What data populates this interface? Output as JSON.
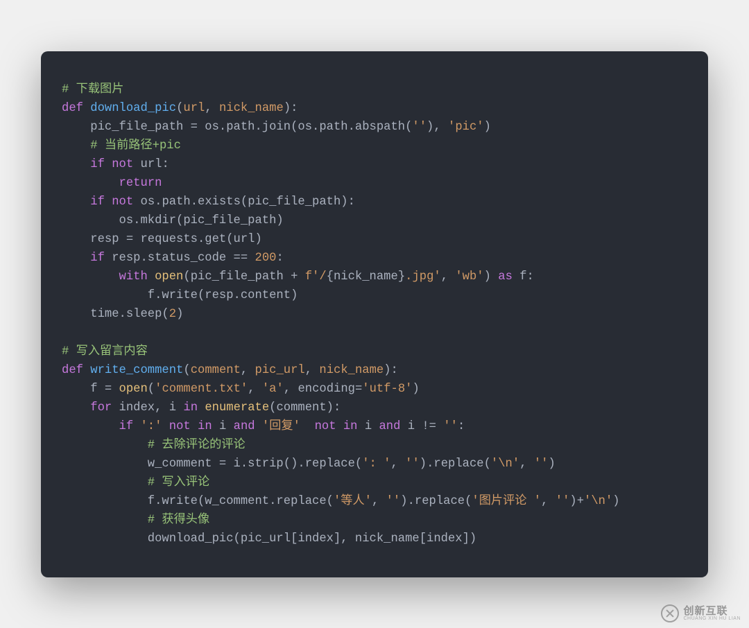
{
  "code": {
    "lines": [
      {
        "indent": 0,
        "tokens": [
          {
            "cls": "c-comment",
            "text": "# 下载图片"
          }
        ]
      },
      {
        "indent": 0,
        "tokens": [
          {
            "cls": "c-keyword",
            "text": "def"
          },
          {
            "cls": "c-punct",
            "text": " "
          },
          {
            "cls": "c-funcname",
            "text": "download_pic"
          },
          {
            "cls": "c-punct",
            "text": "("
          },
          {
            "cls": "c-param",
            "text": "url"
          },
          {
            "cls": "c-punct",
            "text": ", "
          },
          {
            "cls": "c-param",
            "text": "nick_name"
          },
          {
            "cls": "c-punct",
            "text": "):"
          }
        ]
      },
      {
        "indent": 1,
        "tokens": [
          {
            "cls": "c-ident",
            "text": "pic_file_path = os.path.join(os.path.abspath("
          },
          {
            "cls": "c-string",
            "text": "''"
          },
          {
            "cls": "c-ident",
            "text": "), "
          },
          {
            "cls": "c-string",
            "text": "'pic'"
          },
          {
            "cls": "c-ident",
            "text": ")"
          }
        ]
      },
      {
        "indent": 1,
        "tokens": [
          {
            "cls": "c-comment",
            "text": "# 当前路径+pic"
          }
        ]
      },
      {
        "indent": 1,
        "tokens": [
          {
            "cls": "c-keyword",
            "text": "if"
          },
          {
            "cls": "c-ident",
            "text": " "
          },
          {
            "cls": "c-keyword",
            "text": "not"
          },
          {
            "cls": "c-ident",
            "text": " url:"
          }
        ]
      },
      {
        "indent": 2,
        "tokens": [
          {
            "cls": "c-keyword",
            "text": "return"
          }
        ]
      },
      {
        "indent": 1,
        "tokens": [
          {
            "cls": "c-keyword",
            "text": "if"
          },
          {
            "cls": "c-ident",
            "text": " "
          },
          {
            "cls": "c-keyword",
            "text": "not"
          },
          {
            "cls": "c-ident",
            "text": " os.path.exists(pic_file_path):"
          }
        ]
      },
      {
        "indent": 2,
        "tokens": [
          {
            "cls": "c-ident",
            "text": "os.mkdir(pic_file_path)"
          }
        ]
      },
      {
        "indent": 1,
        "tokens": [
          {
            "cls": "c-ident",
            "text": "resp = requests.get(url)"
          }
        ]
      },
      {
        "indent": 1,
        "tokens": [
          {
            "cls": "c-keyword",
            "text": "if"
          },
          {
            "cls": "c-ident",
            "text": " resp.status_code == "
          },
          {
            "cls": "c-number",
            "text": "200"
          },
          {
            "cls": "c-ident",
            "text": ":"
          }
        ]
      },
      {
        "indent": 2,
        "tokens": [
          {
            "cls": "c-keyword",
            "text": "with"
          },
          {
            "cls": "c-ident",
            "text": " "
          },
          {
            "cls": "c-builtin",
            "text": "open"
          },
          {
            "cls": "c-ident",
            "text": "(pic_file_path + "
          },
          {
            "cls": "c-string",
            "text": "f'/"
          },
          {
            "cls": "c-fstr-brace",
            "text": "{nick_name}"
          },
          {
            "cls": "c-string",
            "text": ".jpg'"
          },
          {
            "cls": "c-ident",
            "text": ", "
          },
          {
            "cls": "c-string",
            "text": "'wb'"
          },
          {
            "cls": "c-ident",
            "text": ") "
          },
          {
            "cls": "c-keyword",
            "text": "as"
          },
          {
            "cls": "c-ident",
            "text": " f:"
          }
        ]
      },
      {
        "indent": 3,
        "tokens": [
          {
            "cls": "c-ident",
            "text": "f.write(resp.content)"
          }
        ]
      },
      {
        "indent": 1,
        "tokens": [
          {
            "cls": "c-ident",
            "text": "time.sleep("
          },
          {
            "cls": "c-number",
            "text": "2"
          },
          {
            "cls": "c-ident",
            "text": ")"
          }
        ]
      },
      {
        "indent": 0,
        "tokens": []
      },
      {
        "indent": 0,
        "tokens": [
          {
            "cls": "c-comment",
            "text": "# 写入留言内容"
          }
        ]
      },
      {
        "indent": 0,
        "tokens": [
          {
            "cls": "c-keyword",
            "text": "def"
          },
          {
            "cls": "c-punct",
            "text": " "
          },
          {
            "cls": "c-funcname",
            "text": "write_comment"
          },
          {
            "cls": "c-punct",
            "text": "("
          },
          {
            "cls": "c-param",
            "text": "comment"
          },
          {
            "cls": "c-punct",
            "text": ", "
          },
          {
            "cls": "c-param",
            "text": "pic_url"
          },
          {
            "cls": "c-punct",
            "text": ", "
          },
          {
            "cls": "c-param",
            "text": "nick_name"
          },
          {
            "cls": "c-punct",
            "text": "):"
          }
        ]
      },
      {
        "indent": 1,
        "tokens": [
          {
            "cls": "c-ident",
            "text": "f = "
          },
          {
            "cls": "c-builtin",
            "text": "open"
          },
          {
            "cls": "c-ident",
            "text": "("
          },
          {
            "cls": "c-string",
            "text": "'comment.txt'"
          },
          {
            "cls": "c-ident",
            "text": ", "
          },
          {
            "cls": "c-string",
            "text": "'a'"
          },
          {
            "cls": "c-ident",
            "text": ", encoding="
          },
          {
            "cls": "c-string",
            "text": "'utf-8'"
          },
          {
            "cls": "c-ident",
            "text": ")"
          }
        ]
      },
      {
        "indent": 1,
        "tokens": [
          {
            "cls": "c-keyword",
            "text": "for"
          },
          {
            "cls": "c-ident",
            "text": " index, i "
          },
          {
            "cls": "c-keyword",
            "text": "in"
          },
          {
            "cls": "c-ident",
            "text": " "
          },
          {
            "cls": "c-builtin",
            "text": "enumerate"
          },
          {
            "cls": "c-ident",
            "text": "(comment):"
          }
        ]
      },
      {
        "indent": 2,
        "tokens": [
          {
            "cls": "c-keyword",
            "text": "if"
          },
          {
            "cls": "c-ident",
            "text": " "
          },
          {
            "cls": "c-string",
            "text": "':'"
          },
          {
            "cls": "c-ident",
            "text": " "
          },
          {
            "cls": "c-keyword",
            "text": "not"
          },
          {
            "cls": "c-ident",
            "text": " "
          },
          {
            "cls": "c-keyword",
            "text": "in"
          },
          {
            "cls": "c-ident",
            "text": " i "
          },
          {
            "cls": "c-keyword",
            "text": "and"
          },
          {
            "cls": "c-ident",
            "text": " "
          },
          {
            "cls": "c-string",
            "text": "'回复'"
          },
          {
            "cls": "c-ident",
            "text": "  "
          },
          {
            "cls": "c-keyword",
            "text": "not"
          },
          {
            "cls": "c-ident",
            "text": " "
          },
          {
            "cls": "c-keyword",
            "text": "in"
          },
          {
            "cls": "c-ident",
            "text": " i "
          },
          {
            "cls": "c-keyword",
            "text": "and"
          },
          {
            "cls": "c-ident",
            "text": " i != "
          },
          {
            "cls": "c-string",
            "text": "''"
          },
          {
            "cls": "c-ident",
            "text": ":"
          }
        ]
      },
      {
        "indent": 3,
        "tokens": [
          {
            "cls": "c-comment",
            "text": "# 去除评论的评论"
          }
        ]
      },
      {
        "indent": 3,
        "tokens": [
          {
            "cls": "c-ident",
            "text": "w_comment = i.strip().replace("
          },
          {
            "cls": "c-string",
            "text": "': '"
          },
          {
            "cls": "c-ident",
            "text": ", "
          },
          {
            "cls": "c-string",
            "text": "''"
          },
          {
            "cls": "c-ident",
            "text": ").replace("
          },
          {
            "cls": "c-string",
            "text": "'\\n'"
          },
          {
            "cls": "c-ident",
            "text": ", "
          },
          {
            "cls": "c-string",
            "text": "''"
          },
          {
            "cls": "c-ident",
            "text": ")"
          }
        ]
      },
      {
        "indent": 3,
        "tokens": [
          {
            "cls": "c-comment",
            "text": "# 写入评论"
          }
        ]
      },
      {
        "indent": 3,
        "tokens": [
          {
            "cls": "c-ident",
            "text": "f.write(w_comment.replace("
          },
          {
            "cls": "c-string",
            "text": "'等人'"
          },
          {
            "cls": "c-ident",
            "text": ", "
          },
          {
            "cls": "c-string",
            "text": "''"
          },
          {
            "cls": "c-ident",
            "text": ").replace("
          },
          {
            "cls": "c-string",
            "text": "'图片评论 '"
          },
          {
            "cls": "c-ident",
            "text": ", "
          },
          {
            "cls": "c-string",
            "text": "''"
          },
          {
            "cls": "c-ident",
            "text": ")+"
          },
          {
            "cls": "c-string",
            "text": "'\\n'"
          },
          {
            "cls": "c-ident",
            "text": ")"
          }
        ]
      },
      {
        "indent": 3,
        "tokens": [
          {
            "cls": "c-comment",
            "text": "# 获得头像"
          }
        ]
      },
      {
        "indent": 3,
        "tokens": [
          {
            "cls": "c-ident",
            "text": "download_pic(pic_url[index], nick_name[index])"
          }
        ]
      }
    ],
    "indent_unit": "    "
  },
  "watermark": {
    "cn": "创新互联",
    "en": "CHUANG XIN HU LIAN"
  }
}
